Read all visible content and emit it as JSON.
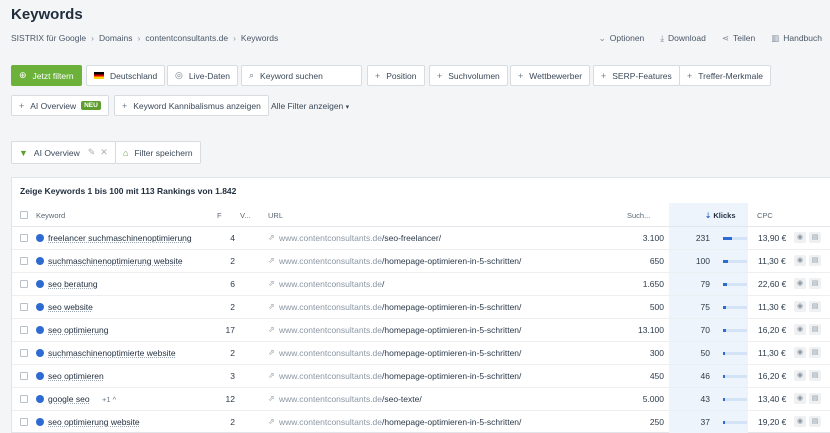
{
  "page": {
    "title": "Keywords"
  },
  "breadcrumb": [
    "SISTRIX für Google",
    "Domains",
    "contentconsultants.de",
    "Keywords"
  ],
  "top_actions": {
    "options": "Optionen",
    "download": "Download",
    "share": "Teilen",
    "handbook": "Handbuch"
  },
  "filters": {
    "apply": "Jetzt filtern",
    "country": "Deutschland",
    "live": "Live-Daten",
    "search_placeholder": "Keyword suchen",
    "position": "Position",
    "volume": "Suchvolumen",
    "competitor": "Wettbewerber",
    "serp": "SERP-Features",
    "hit": "Treffer-Merkmale",
    "ai_overview": "AI Overview",
    "ai_badge": "NEU",
    "cannibal": "Keyword Kannibalismus anzeigen",
    "all_filters": "Alle Filter anzeigen"
  },
  "active_filters": {
    "ai_overview": "AI Overview",
    "save": "Filter speichern"
  },
  "table": {
    "summary": "Zeige Keywords 1 bis 100 mit 113 Rankings von 1.842",
    "headers": {
      "keyword": "Keyword",
      "f": "F",
      "v": "V...",
      "url": "URL",
      "search": "Such...",
      "klicks": "Klicks",
      "cpc": "CPC"
    },
    "rows": [
      {
        "keyword": "freelancer suchmaschinenoptimierung",
        "pos": "4",
        "domain": "www.contentconsultants.de",
        "path": "/seo-freelancer/",
        "volume": "3.100",
        "klicks": "231",
        "klicks_pct": 0.36,
        "cpc": "13,90 €"
      },
      {
        "keyword": "suchmaschinenoptimierung website",
        "pos": "2",
        "domain": "www.contentconsultants.de",
        "path": "/homepage-optimieren-in-5-schritten/",
        "volume": "650",
        "klicks": "100",
        "klicks_pct": 0.2,
        "cpc": "11,30 €"
      },
      {
        "keyword": "seo beratung",
        "pos": "6",
        "domain": "www.contentconsultants.de",
        "path": "/",
        "volume": "1.650",
        "klicks": "79",
        "klicks_pct": 0.15,
        "cpc": "22,60 €"
      },
      {
        "keyword": "seo website",
        "pos": "2",
        "domain": "www.contentconsultants.de",
        "path": "/homepage-optimieren-in-5-schritten/",
        "volume": "500",
        "klicks": "75",
        "klicks_pct": 0.14,
        "cpc": "11,30 €"
      },
      {
        "keyword": "seo optimierung",
        "pos": "17",
        "domain": "www.contentconsultants.de",
        "path": "/homepage-optimieren-in-5-schritten/",
        "volume": "13.100",
        "klicks": "70",
        "klicks_pct": 0.13,
        "cpc": "16,20 €"
      },
      {
        "keyword": "suchmaschinenoptimierte website",
        "pos": "2",
        "domain": "www.contentconsultants.de",
        "path": "/homepage-optimieren-in-5-schritten/",
        "volume": "300",
        "klicks": "50",
        "klicks_pct": 0.1,
        "cpc": "11,30 €"
      },
      {
        "keyword": "seo optimieren",
        "pos": "3",
        "domain": "www.contentconsultants.de",
        "path": "/homepage-optimieren-in-5-schritten/",
        "volume": "450",
        "klicks": "46",
        "klicks_pct": 0.09,
        "cpc": "16,20 €"
      },
      {
        "keyword": "google seo",
        "extra": "+1",
        "pos": "12",
        "domain": "www.contentconsultants.de",
        "path": "/seo-texte/",
        "volume": "5.000",
        "klicks": "43",
        "klicks_pct": 0.08,
        "cpc": "13,40 €"
      },
      {
        "keyword": "seo optimierung website",
        "pos": "2",
        "domain": "www.contentconsultants.de",
        "path": "/homepage-optimieren-in-5-schritten/",
        "volume": "250",
        "klicks": "37",
        "klicks_pct": 0.07,
        "cpc": "19,20 €"
      }
    ]
  }
}
